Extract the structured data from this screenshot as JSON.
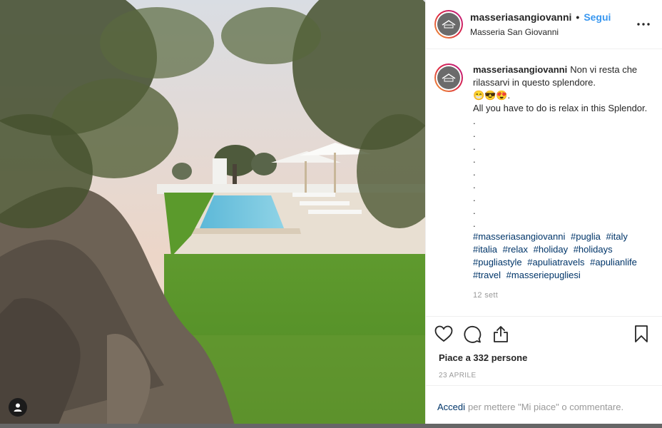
{
  "post": {
    "username": "masseriasangiovanni",
    "separator": "•",
    "follow_label": "Segui",
    "location": "Masseria San Giovanni"
  },
  "caption": {
    "username": "masseriasangiovanni",
    "line1": "Non vi resta che rilassarvi in questo splendore.",
    "emojis": "😁😎😍.",
    "line2": "All you have to do is relax in this Splendor.",
    "dots": [
      ".",
      ".",
      ".",
      ".",
      ".",
      ".",
      ".",
      ".",
      "."
    ],
    "hashtags": [
      "#masseriasangiovanni",
      "#puglia",
      "#italy",
      "#italia",
      "#relax",
      "#holiday",
      "#holidays",
      "#pugliastyle",
      "#apuliatravels",
      "#apulianlife",
      "#travel",
      "#masseriepugliesi"
    ],
    "time": "12 sett"
  },
  "actions": {
    "likes_text": "Piace a 332 persone",
    "date": "23 APRILE"
  },
  "login": {
    "link": "Accedi",
    "text": "per mettere \"Mi piace\" o commentare."
  },
  "icons": {
    "like": "heart-icon",
    "comment": "comment-icon",
    "share": "share-icon",
    "save": "bookmark-icon",
    "more": "more-options-icon",
    "user_tag": "user-tag-icon"
  },
  "colors": {
    "link": "#3897f0",
    "hashtag": "#003569",
    "muted": "#999999"
  }
}
